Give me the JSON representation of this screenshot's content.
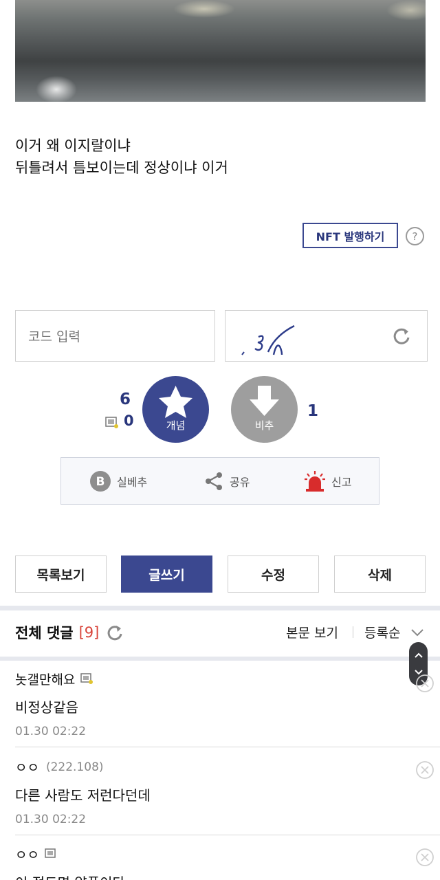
{
  "post": {
    "lines": [
      "이거 왜 이지랄이냐",
      "뒤틀려서 틈보이는데 정상이냐 이거"
    ]
  },
  "nft": {
    "label": "NFT 발행하기",
    "help": "?"
  },
  "captcha": {
    "placeholder": "코드 입력"
  },
  "votes": {
    "up_count": "6",
    "fixed_count": "0",
    "up_label": "개념",
    "down_label": "비추",
    "down_count": "1"
  },
  "actions": [
    {
      "label": "실베추",
      "icon": "best-b-icon"
    },
    {
      "label": "공유",
      "icon": "share-icon"
    },
    {
      "label": "신고",
      "icon": "siren-icon"
    }
  ],
  "buttons": {
    "list": "목록보기",
    "write": "글쓰기",
    "edit": "수정",
    "delete": "삭제"
  },
  "comments_header": {
    "title": "전체 댓글",
    "count": "[9]",
    "view_body": "본문 보기",
    "sort": "등록순"
  },
  "comments": [
    {
      "nick": "놋갤만해요",
      "ip": "",
      "body": "비정상같음",
      "date": "01.30 02:22"
    },
    {
      "nick": "ㅇㅇ",
      "ip": "(222.108)",
      "body": "다른 사람도 저런다던데",
      "date": "01.30 02:22"
    },
    {
      "nick": "ㅇㅇ",
      "ip": "",
      "body": "이 정도면 양품이다",
      "date": ""
    }
  ],
  "colors": {
    "accent": "#3b4890",
    "count_red": "#d8443a",
    "downvote": "#9e9e9e"
  }
}
